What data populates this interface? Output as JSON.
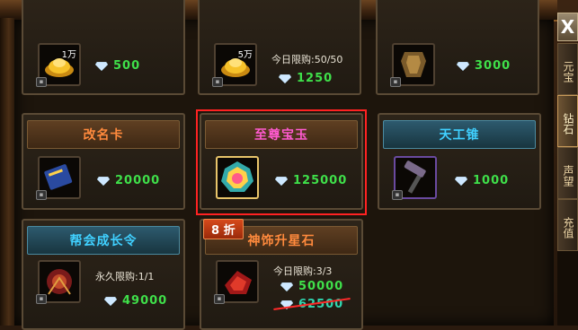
{
  "close_label": "X",
  "side_tabs": [
    {
      "label": "元宝",
      "active": false
    },
    {
      "label": "钻石",
      "active": true
    },
    {
      "label": "声望",
      "active": false
    },
    {
      "label": "充值",
      "active": false
    }
  ],
  "items": [
    {
      "id": "gold-1w",
      "qty": "1万",
      "price": "500",
      "limit": ""
    },
    {
      "id": "gold-5w",
      "qty": "5万",
      "price": "1250",
      "limit": "今日限购:50/50"
    },
    {
      "id": "armor",
      "qty": "",
      "price": "3000",
      "limit": ""
    },
    {
      "id": "rename",
      "title": "改名卡",
      "price": "20000",
      "limit": ""
    },
    {
      "id": "supreme",
      "title": "至尊宝玉",
      "price": "125000",
      "limit": ""
    },
    {
      "id": "hammer",
      "title": "天工锥",
      "price": "1000",
      "limit": ""
    },
    {
      "id": "guild",
      "title": "帮会成长令",
      "price": "49000",
      "limit": "永久限购:1/1"
    },
    {
      "id": "stone",
      "title": "神饰升星石",
      "price": "50000",
      "old_price": "62500",
      "limit": "今日限购:3/3",
      "discount": "8 折"
    }
  ],
  "colors": {
    "title_orange": "#ff8a3d",
    "title_cyan": "#40d0ff",
    "price_green": "#3fe04a",
    "highlight_red": "#ff2222"
  }
}
